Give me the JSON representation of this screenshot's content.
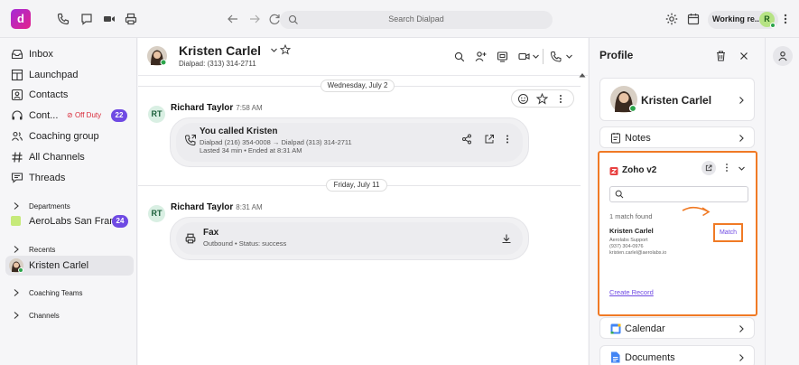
{
  "app": {
    "logo_letter": "d"
  },
  "topbar": {
    "search_placeholder": "Search Dialpad",
    "status_label": "Working re...",
    "user_initial": "R"
  },
  "sidebar": {
    "items": [
      {
        "label": "Inbox",
        "icon": "inbox-icon"
      },
      {
        "label": "Launchpad",
        "icon": "launchpad-icon"
      },
      {
        "label": "Contacts",
        "icon": "contacts-icon"
      },
      {
        "label": "Cont...",
        "icon": "headset-icon",
        "status": "Off Duty",
        "badge": "22"
      },
      {
        "label": "Coaching group",
        "icon": "group-icon"
      },
      {
        "label": "All Channels",
        "icon": "hash-icon"
      },
      {
        "label": "Threads",
        "icon": "threads-icon"
      }
    ],
    "departments_label": "Departments",
    "department": {
      "label": "AeroLabs San Fran...",
      "badge": "24",
      "color": "#c6ea7a"
    },
    "recents_label": "Recents",
    "recent_contact": "Kristen Carlel",
    "coaching_teams_label": "Coaching Teams",
    "channels_label": "Channels"
  },
  "conversation": {
    "contact_name": "Kristen Carlel",
    "contact_sub": "Dialpad: (313) 314-2711",
    "days": [
      {
        "date": "Wednesday, July 2",
        "sender_initials": "RT",
        "sender": "Richard Taylor",
        "time": "7:58 AM",
        "card_title": "You called Kristen",
        "card_line1": "Dialpad (216) 354-0008 → Dialpad (313) 314-2711",
        "card_line2": "Lasted 34 min • Ended at 8:31 AM"
      },
      {
        "date": "Friday, July 11",
        "sender_initials": "RT",
        "sender": "Richard Taylor",
        "time": "8:31 AM",
        "card_title": "Fax",
        "card_line1": "Outbound • Status: success"
      }
    ]
  },
  "profile": {
    "title": "Profile",
    "contact_name": "Kristen Carlel",
    "notes_label": "Notes",
    "zoho": {
      "title": "Zoho v2",
      "match_count": "1 match found",
      "match_name": "Kristen Carlel",
      "match_company": "Aerolabs Support",
      "match_phone": "(937) 304-0976",
      "match_email": "kristen.carlel@aerolabs.io",
      "match_button": "Match",
      "create_record": "Create Record",
      "highlight_color": "#f07a25"
    },
    "calendar_label": "Calendar",
    "documents_label": "Documents"
  },
  "colors": {
    "accent": "#6f4ae3",
    "off_duty": "#d92b3a",
    "online": "#2ba44a"
  }
}
